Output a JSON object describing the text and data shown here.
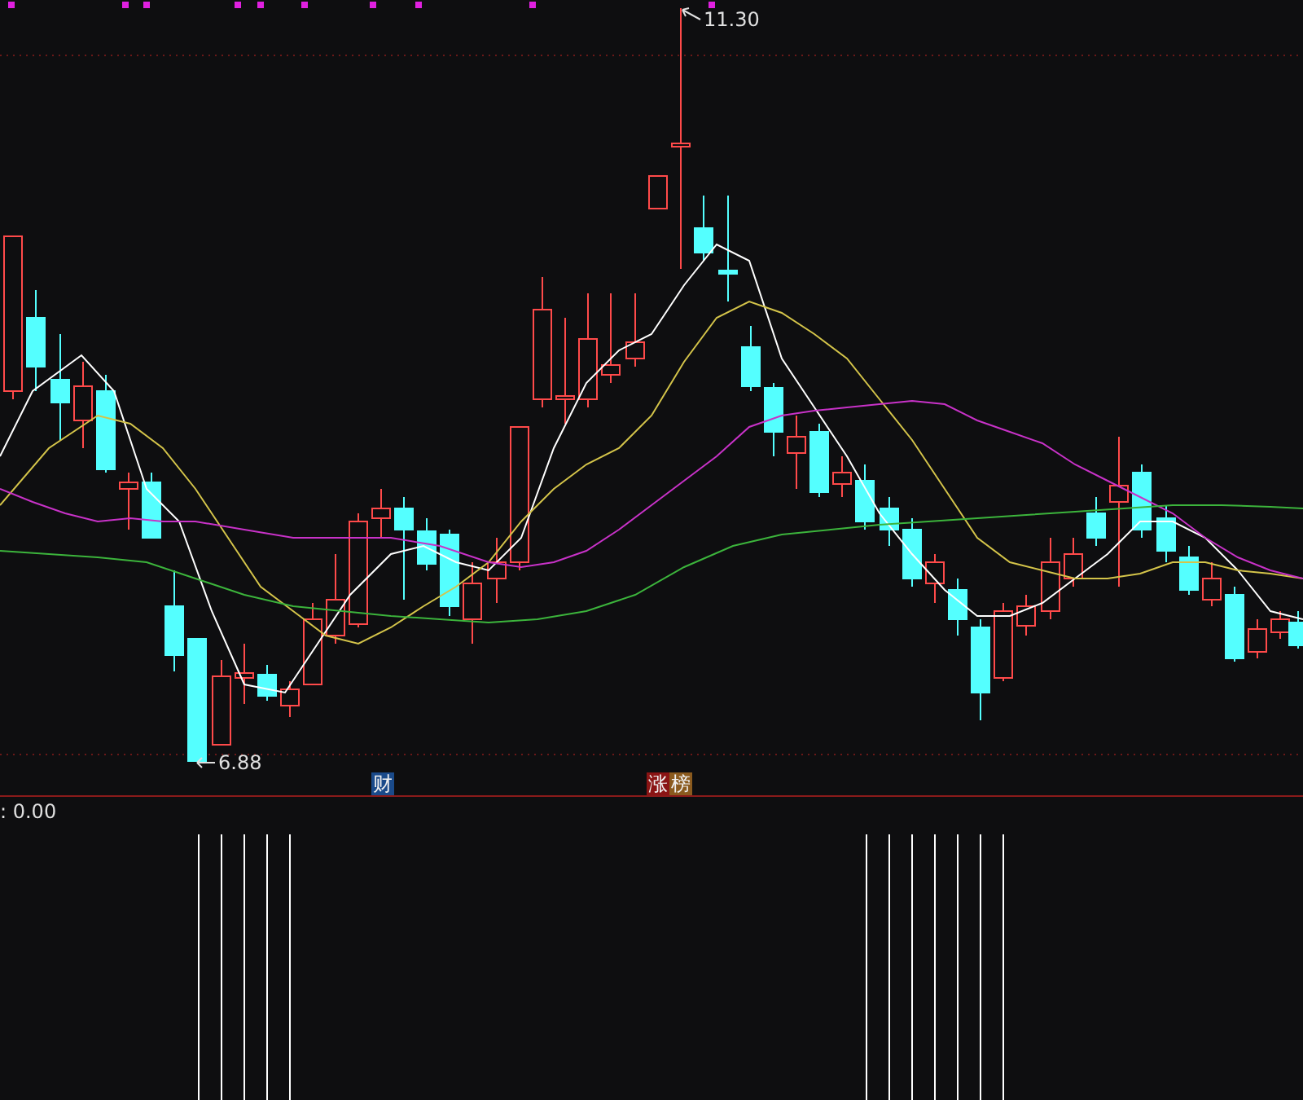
{
  "main_chart": {
    "high_label": "11.30",
    "low_label": "6.88",
    "event_badges": [
      {
        "text": "财",
        "kind": "finance"
      },
      {
        "text": "涨",
        "kind": "limit-up"
      },
      {
        "text": "榜",
        "kind": "ranking"
      }
    ]
  },
  "indicator_panel": {
    "value_label": ": 0.00"
  }
}
